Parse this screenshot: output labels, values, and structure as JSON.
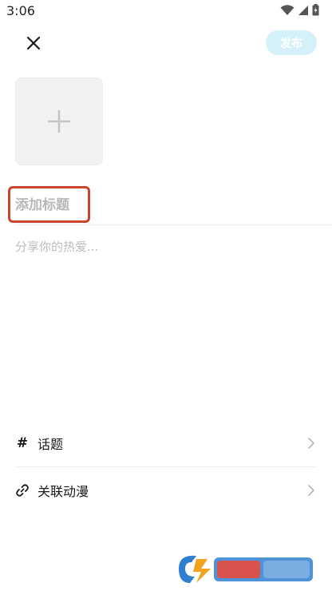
{
  "status_bar": {
    "time": "3:06"
  },
  "header": {
    "publish_label": "发布"
  },
  "editor": {
    "title_placeholder": "添加标题",
    "content_placeholder": "分享你的热爱..."
  },
  "options": [
    {
      "label": "话题",
      "icon": "hash-icon"
    },
    {
      "label": "关联动漫",
      "icon": "link-icon"
    }
  ],
  "colors": {
    "publish_bg": "#d4f1fa",
    "title_highlight": "#c9452b",
    "placeholder": "#b8b8b8"
  }
}
